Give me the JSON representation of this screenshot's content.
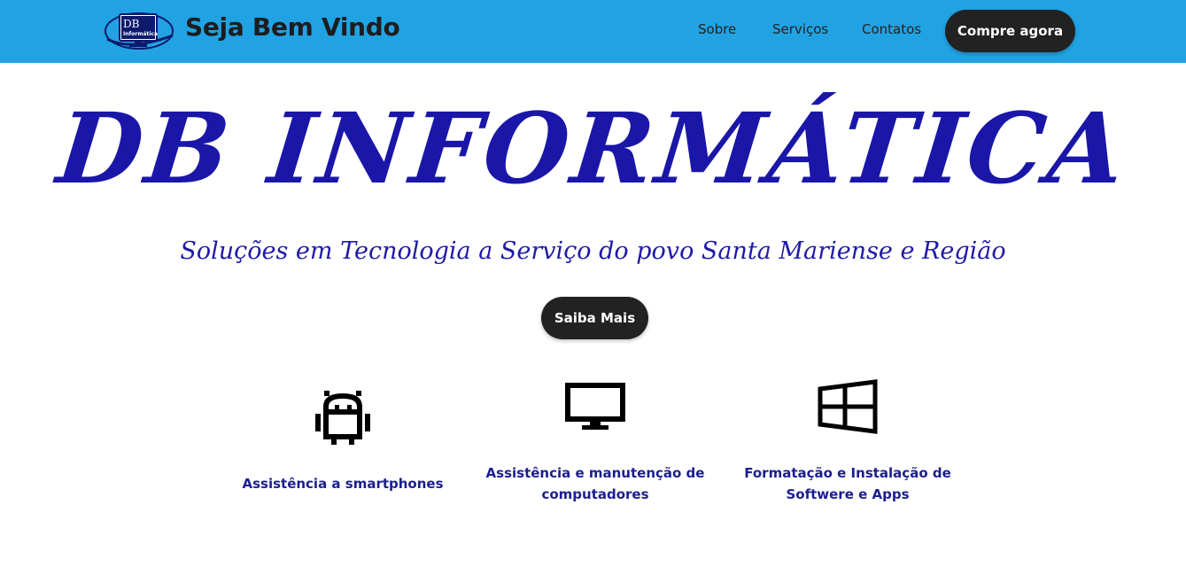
{
  "header": {
    "logo_text_top": "DB",
    "logo_text_bottom": "Informática",
    "title": "Seja Bem Vindo",
    "nav": [
      "Sobre",
      "Serviços",
      "Contatos"
    ],
    "cta_label": "Compre agora",
    "background_color": "#21a3e3"
  },
  "hero": {
    "title": "DB INFORMÁTICA",
    "subtitle": "Soluções em Tecnologia a Serviço do povo Santa Mariense e Região",
    "button_label": "Saiba Mais",
    "title_color": "#1a16a8"
  },
  "services": [
    {
      "icon": "android-icon",
      "label": "Assistência a smartphones"
    },
    {
      "icon": "monitor-icon",
      "label": "Assistência e manutenção de computadores"
    },
    {
      "icon": "windows-icon",
      "label": "Formatação e Instalação de Softwere e Apps"
    }
  ]
}
